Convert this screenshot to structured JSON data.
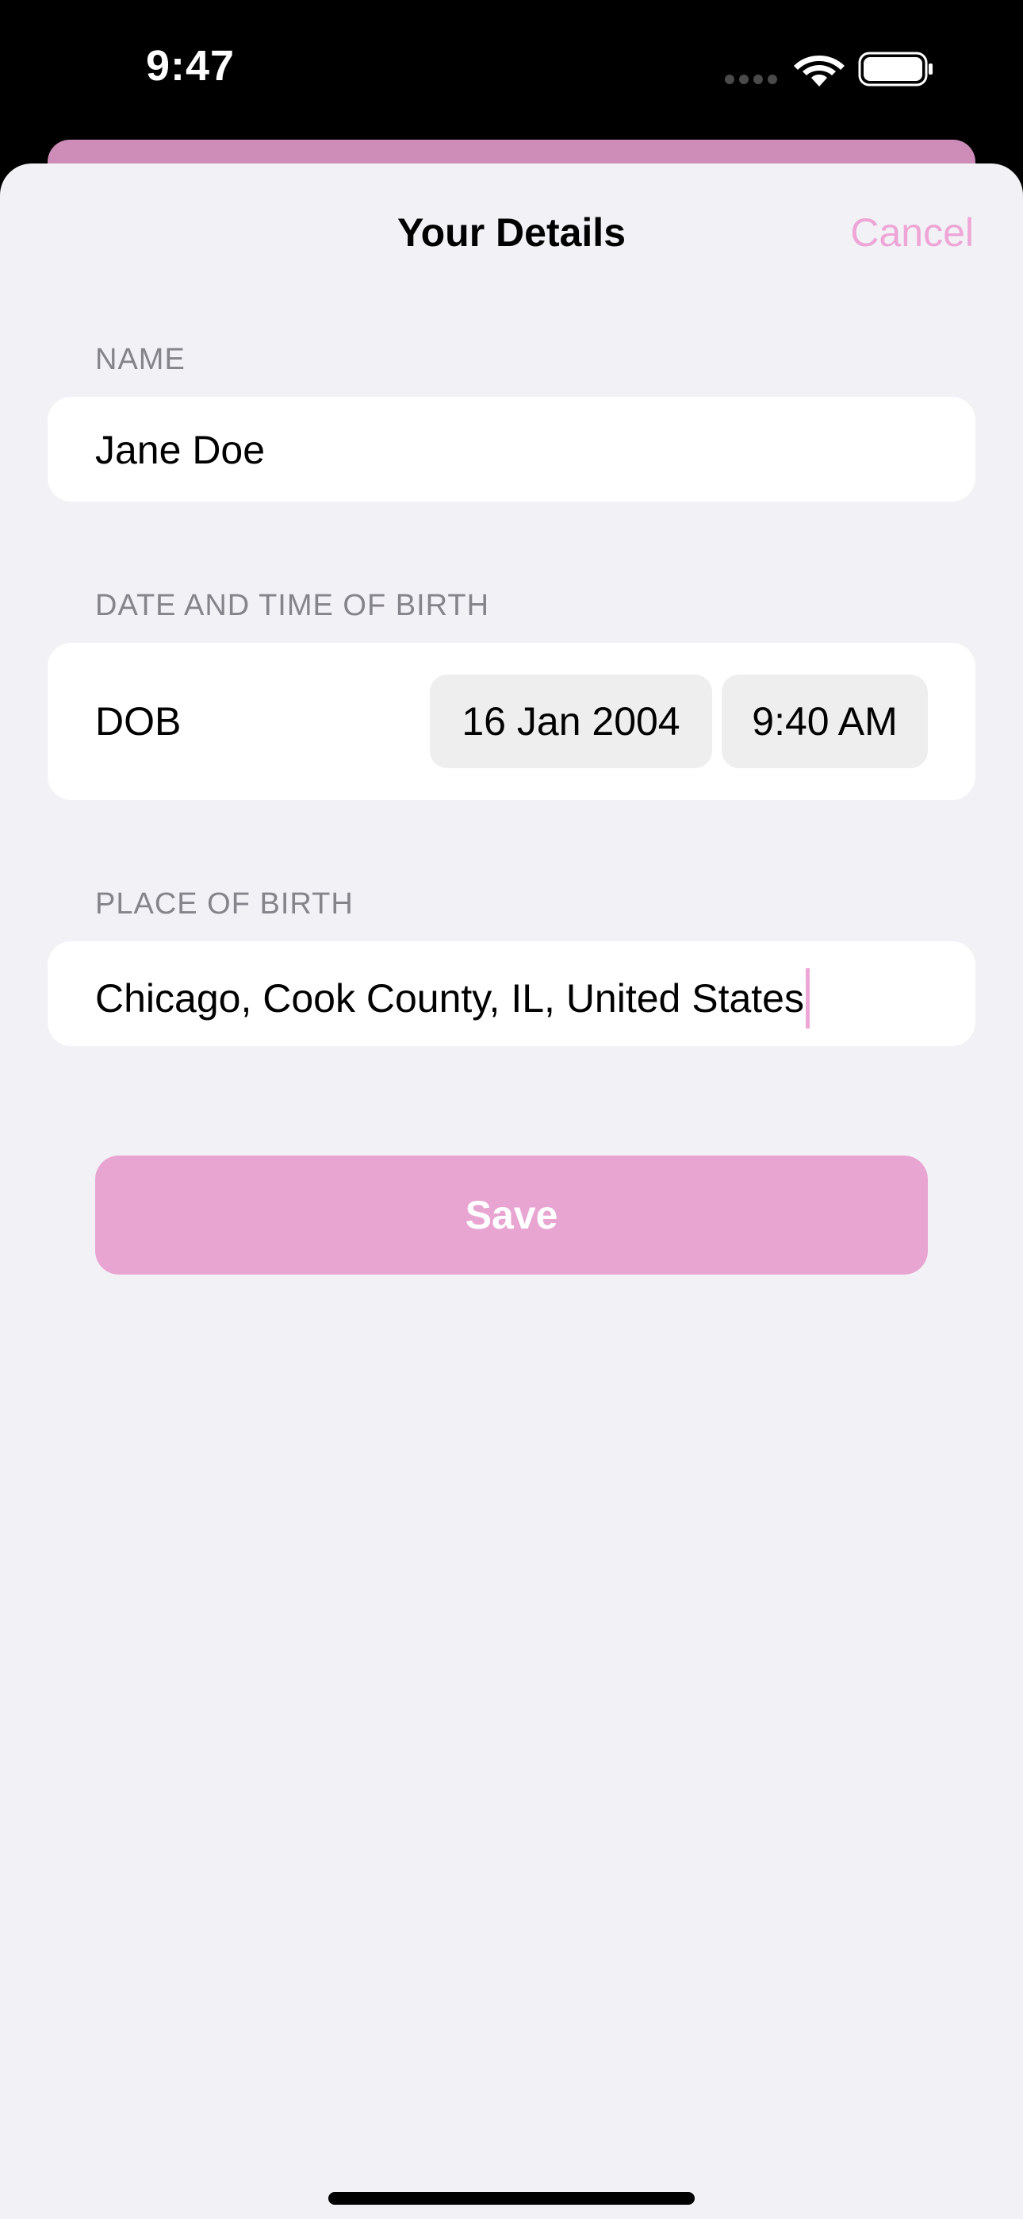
{
  "status_bar": {
    "time": "9:47",
    "wifi_icon": "wifi-icon",
    "battery_icon": "battery-full-icon"
  },
  "header": {
    "title": "Your Details",
    "cancel_label": "Cancel"
  },
  "name_section": {
    "label": "NAME",
    "value": "Jane Doe"
  },
  "birth_section": {
    "label": "DATE AND TIME OF BIRTH",
    "row_label": "DOB",
    "date": "16 Jan 2004",
    "time": "9:40 AM"
  },
  "place_section": {
    "label": "PLACE OF BIRTH",
    "value": "Chicago, Cook County, IL, United States"
  },
  "save_label": "Save",
  "colors": {
    "accent": "#eea6d6",
    "save_button": "#e8a5d2",
    "background": "#f2f1f6",
    "behind_sheet": "#cd8db8"
  }
}
